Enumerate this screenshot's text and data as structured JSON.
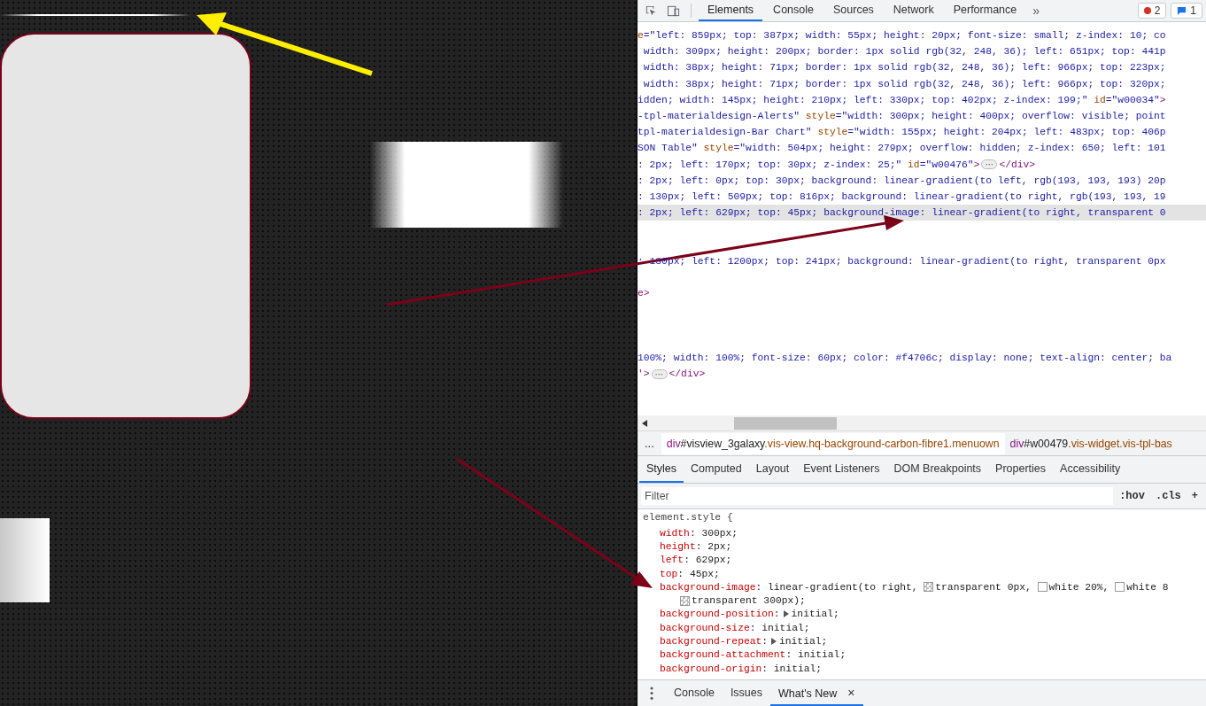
{
  "canvas": {
    "shapes": [
      {
        "kind": "gradient-line"
      },
      {
        "kind": "panel"
      },
      {
        "kind": "faded-block"
      },
      {
        "kind": "edge-block"
      }
    ]
  },
  "devtools": {
    "toolbar": {
      "tabs": [
        {
          "label": "Elements",
          "selected": true
        },
        {
          "label": "Console",
          "selected": false
        },
        {
          "label": "Sources",
          "selected": false
        },
        {
          "label": "Network",
          "selected": false
        },
        {
          "label": "Performance",
          "selected": false
        }
      ],
      "more": "»",
      "error_count": "2",
      "message_count": "1"
    },
    "elements_lines": [
      {
        "kind": "code",
        "selected": false,
        "parts": [
          {
            "kind": "attr",
            "text": "e"
          },
          {
            "kind": "val",
            "text": "=\"left: 859px; top: 387px; width: 55px; height: 20px; font-size: small; z-index: 10; co"
          }
        ]
      },
      {
        "kind": "code",
        "selected": false,
        "parts": [
          {
            "kind": "val",
            "text": " width: 309px; height: 200px; border: 1px solid rgb(32, 248, 36); left: 651px; top: 441p"
          }
        ]
      },
      {
        "kind": "code",
        "selected": false,
        "parts": [
          {
            "kind": "val",
            "text": " width: 38px; height: 71px; border: 1px solid rgb(32, 248, 36); left: 966px; top: 223px;"
          }
        ]
      },
      {
        "kind": "code",
        "selected": false,
        "parts": [
          {
            "kind": "val",
            "text": " width: 38px; height: 71px; border: 1px solid rgb(32, 248, 36); left: 966px; top: 320px;"
          }
        ]
      },
      {
        "kind": "code",
        "selected": false,
        "parts": [
          {
            "kind": "val",
            "text": "idden; width: 145px; height: 210px; left: 330px; top: 402px; z-index: 199;\""
          },
          {
            "kind": "attr",
            "text": " id"
          },
          {
            "kind": "val",
            "text": "=\"w00034\""
          },
          {
            "kind": "tag",
            "text": ">"
          }
        ]
      },
      {
        "kind": "code",
        "selected": false,
        "parts": [
          {
            "kind": "val",
            "text": "-tpl-materialdesign-Alerts\""
          },
          {
            "kind": "attr",
            "text": " style"
          },
          {
            "kind": "val",
            "text": "=\"width: 300px; height: 400px; overflow: visible; point"
          }
        ]
      },
      {
        "kind": "code",
        "selected": false,
        "parts": [
          {
            "kind": "val",
            "text": "tpl-materialdesign-Bar Chart\""
          },
          {
            "kind": "attr",
            "text": " style"
          },
          {
            "kind": "val",
            "text": "=\"width: 155px; height: 204px; left: 483px; top: 406p"
          }
        ]
      },
      {
        "kind": "code",
        "selected": false,
        "parts": [
          {
            "kind": "val",
            "text": "SON Table\""
          },
          {
            "kind": "attr",
            "text": " style"
          },
          {
            "kind": "val",
            "text": "=\"width: 504px; height: 279px; overflow: hidden; z-index: 650; left: 101"
          }
        ]
      },
      {
        "kind": "code",
        "selected": false,
        "parts": [
          {
            "kind": "val",
            "text": ": 2px; left: 170px; top: 30px; z-index: 25;\""
          },
          {
            "kind": "attr",
            "text": " id"
          },
          {
            "kind": "val",
            "text": "=\"w00476\""
          },
          {
            "kind": "tag",
            "text": ">"
          }
        ],
        "expander": "⋯",
        "after": [
          {
            "kind": "tag",
            "text": "</div>"
          }
        ]
      },
      {
        "kind": "code",
        "selected": false,
        "parts": [
          {
            "kind": "val",
            "text": ": 2px; left: 0px; top: 30px; background: linear-gradient(to left, rgb(193, 193, 193) 20p"
          }
        ]
      },
      {
        "kind": "code",
        "selected": false,
        "parts": [
          {
            "kind": "val",
            "text": ": 130px; left: 509px; top: 816px; background: linear-gradient(to right, rgb(193, 193, 19"
          }
        ]
      },
      {
        "kind": "code",
        "selected": true,
        "parts": [
          {
            "kind": "val",
            "text": ": 2px; left: 629px; top: 45px; background-image: linear-gradient(to right, transparent 0"
          }
        ]
      },
      {
        "kind": "blank"
      },
      {
        "kind": "blank"
      },
      {
        "kind": "code",
        "selected": false,
        "parts": [
          {
            "kind": "val",
            "text": ": 130px; left: 1200px; top: 241px; background: linear-gradient(to right, transparent 0px"
          }
        ]
      },
      {
        "kind": "blank"
      },
      {
        "kind": "code",
        "selected": false,
        "parts": [
          {
            "kind": "tag",
            "text": "e>"
          }
        ]
      },
      {
        "kind": "blank"
      },
      {
        "kind": "blank"
      },
      {
        "kind": "blank"
      },
      {
        "kind": "code",
        "selected": false,
        "parts": [
          {
            "kind": "val",
            "text": "100%; width: 100%; font-size: 60px; color: #f4706c; display: none; text-align: center; ba"
          }
        ]
      },
      {
        "kind": "code",
        "selected": false,
        "parts": [
          {
            "kind": "tag",
            "text": "'>"
          }
        ],
        "expander": "⋯",
        "after": [
          {
            "kind": "tag",
            "text": "</div>"
          }
        ]
      }
    ],
    "breadcrumbs": {
      "more": "...",
      "items": [
        {
          "tag": "div",
          "id": "#visview_3galaxy",
          "classes": ".vis-view.hq-background-carbon-fibre1.menuown",
          "selected": true
        },
        {
          "tag": "div",
          "id": "#w00479",
          "classes": ".vis-widget.vis-tpl-bas",
          "selected": false
        }
      ]
    },
    "sidebar_tabs": [
      {
        "label": "Styles",
        "selected": true
      },
      {
        "label": "Computed",
        "selected": false
      },
      {
        "label": "Layout",
        "selected": false
      },
      {
        "label": "Event Listeners",
        "selected": false
      },
      {
        "label": "DOM Breakpoints",
        "selected": false
      },
      {
        "label": "Properties",
        "selected": false
      },
      {
        "label": "Accessibility",
        "selected": false
      }
    ],
    "filter": {
      "placeholder": "Filter"
    },
    "filter_buttons": [
      ":hov",
      ".cls",
      "+"
    ],
    "rule": {
      "selector": "element.style {",
      "rows": [
        {
          "kind": "declaration",
          "name": "width",
          "parts": [
            {
              "kind": "text",
              "text": ": 300px;"
            }
          ]
        },
        {
          "kind": "declaration",
          "name": "height",
          "parts": [
            {
              "kind": "text",
              "text": ": 2px;"
            }
          ]
        },
        {
          "kind": "declaration",
          "name": "left",
          "parts": [
            {
              "kind": "text",
              "text": ": 629px;"
            }
          ]
        },
        {
          "kind": "declaration",
          "name": "top",
          "parts": [
            {
              "kind": "text",
              "text": ": 45px;"
            }
          ]
        },
        {
          "kind": "declaration",
          "name": "background-image",
          "parts": [
            {
              "kind": "text",
              "text": ": linear-gradient(to right, "
            },
            {
              "kind": "checker-swatch"
            },
            {
              "kind": "text",
              "text": "transparent 0px, "
            },
            {
              "kind": "plain-swatch"
            },
            {
              "kind": "text",
              "text": "white 20%, "
            },
            {
              "kind": "plain-swatch"
            },
            {
              "kind": "text",
              "text": "white 8"
            }
          ]
        },
        {
          "kind": "continuation",
          "parts": [
            {
              "kind": "checker-swatch"
            },
            {
              "kind": "text",
              "text": "transparent 300px);"
            }
          ]
        },
        {
          "kind": "declaration",
          "name": "background-position",
          "parts": [
            {
              "kind": "text",
              "text": ":"
            },
            {
              "kind": "expander"
            },
            {
              "kind": "text",
              "text": "initial;"
            }
          ]
        },
        {
          "kind": "declaration",
          "name": "background-size",
          "parts": [
            {
              "kind": "text",
              "text": ": initial;"
            }
          ]
        },
        {
          "kind": "declaration",
          "name": "background-repeat",
          "parts": [
            {
              "kind": "text",
              "text": ":"
            },
            {
              "kind": "expander"
            },
            {
              "kind": "text",
              "text": "initial;"
            }
          ]
        },
        {
          "kind": "declaration",
          "name": "background-attachment",
          "parts": [
            {
              "kind": "text",
              "text": ": initial;"
            }
          ]
        },
        {
          "kind": "declaration",
          "name": "background-origin",
          "parts": [
            {
              "kind": "text",
              "text": ": initial;"
            }
          ]
        }
      ]
    },
    "drawer": {
      "tabs": [
        {
          "label": "Console",
          "selected": false,
          "closable": false
        },
        {
          "label": "Issues",
          "selected": false,
          "closable": false
        },
        {
          "label": "What's New",
          "selected": true,
          "closable": true
        }
      ],
      "close": "×"
    }
  }
}
